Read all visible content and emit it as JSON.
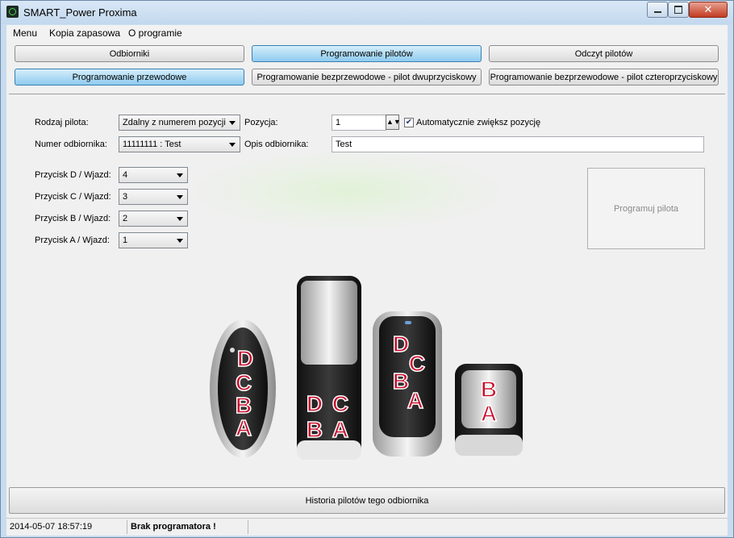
{
  "window": {
    "title": "SMART_Power Proxima",
    "close_glyph": "✕",
    "icon": "app-leaf-icon"
  },
  "menu": [
    "Menu",
    "Kopia zapasowa",
    "O programie"
  ],
  "tabs_top": [
    {
      "label": "Odbiorniki",
      "active": false
    },
    {
      "label": "Programowanie pilotów",
      "active": true
    },
    {
      "label": "Odczyt pilotów",
      "active": false
    }
  ],
  "tabs_sub": [
    {
      "label": "Programowanie przewodowe",
      "active": true
    },
    {
      "label": "Programowanie bezprzewodowe - pilot dwuprzyciskowy",
      "active": false
    },
    {
      "label": "Programowanie bezprzewodowe - pilot czteroprzyciskowy",
      "active": false
    }
  ],
  "form": {
    "remote_type_label": "Rodzaj pilota:",
    "remote_type_value": "Zdalny z numerem pozycji",
    "position_label": "Pozycja:",
    "position_value": "1",
    "auto_increment_label": "Automatycznie zwiększ pozycję",
    "auto_increment_checked": true,
    "receiver_number_label": "Numer odbiornika:",
    "receiver_number_value": "11111111 : Test",
    "receiver_desc_label": "Opis odbiornika:",
    "receiver_desc_value": "Test",
    "buttons": [
      {
        "label": "Przycisk D / Wjazd:",
        "value": "4"
      },
      {
        "label": "Przycisk C / Wjazd:",
        "value": "3"
      },
      {
        "label": "Przycisk B / Wjazd:",
        "value": "2"
      },
      {
        "label": "Przycisk A / Wjazd:",
        "value": "1"
      }
    ],
    "program_button_label": "Programuj pilota"
  },
  "remote_letters": {
    "remote1": [
      "D",
      "C",
      "B",
      "A"
    ],
    "remote2": [
      "D",
      "C",
      "B",
      "A"
    ],
    "remote3": [
      "D",
      "C",
      "B",
      "A"
    ],
    "remote4": [
      "B",
      "A"
    ]
  },
  "history_button_label": "Historia pilotów tego odbiornika",
  "status": {
    "datetime": "2014-05-07 18:57:19",
    "message": "Brak programatora !"
  },
  "colors": {
    "active_tab": "#8ecbef",
    "letter_red": "#c8102e",
    "accent_green": "#e1f2d8"
  }
}
